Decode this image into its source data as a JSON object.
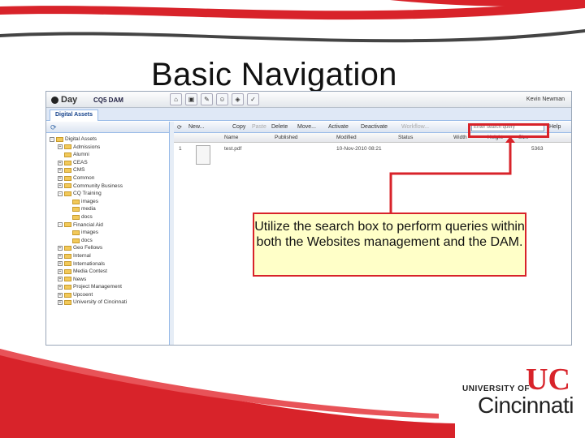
{
  "slide": {
    "title": "Basic Navigation",
    "callout": "Utilize the search box to perform queries within both the Websites management and the DAM.",
    "logo": {
      "top_line": "UNIVERSITY OF",
      "bottom_line": "Cincinnati",
      "mark": "UC"
    },
    "colors": {
      "accent": "#d8232a",
      "callout_bg": "#ffffc8"
    }
  },
  "app": {
    "brand": "Day",
    "product": "CQ5 DAM",
    "toolbar_icons": [
      "home-icon",
      "image-icon",
      "tools-icon",
      "users-icon",
      "site-icon",
      "check-icon"
    ],
    "user": "Kevin Newman"
  },
  "tab": {
    "label": "Digital Assets"
  },
  "tree": {
    "nodes": [
      {
        "label": "Digital Assets",
        "expanded": "-",
        "depth": 0
      },
      {
        "label": "Admissions",
        "expanded": "+",
        "depth": 1
      },
      {
        "label": "Alumni",
        "expanded": "",
        "depth": 1
      },
      {
        "label": "CEAS",
        "expanded": "+",
        "depth": 1
      },
      {
        "label": "CMS",
        "expanded": "+",
        "depth": 1
      },
      {
        "label": "Common",
        "expanded": "+",
        "depth": 1
      },
      {
        "label": "Community Business",
        "expanded": "+",
        "depth": 1
      },
      {
        "label": "CQ Training",
        "expanded": "-",
        "depth": 1
      },
      {
        "label": "images",
        "expanded": "",
        "depth": 2
      },
      {
        "label": "media",
        "expanded": "",
        "depth": 2
      },
      {
        "label": "docs",
        "expanded": "",
        "depth": 2
      },
      {
        "label": "Financial Aid",
        "expanded": "-",
        "depth": 1
      },
      {
        "label": "images",
        "expanded": "",
        "depth": 2
      },
      {
        "label": "docs",
        "expanded": "",
        "depth": 2
      },
      {
        "label": "Geo Fellows",
        "expanded": "+",
        "depth": 1
      },
      {
        "label": "Internal",
        "expanded": "+",
        "depth": 1
      },
      {
        "label": "Internationals",
        "expanded": "+",
        "depth": 1
      },
      {
        "label": "Media Contest",
        "expanded": "+",
        "depth": 1
      },
      {
        "label": "News",
        "expanded": "+",
        "depth": 1
      },
      {
        "label": "Project Management",
        "expanded": "+",
        "depth": 1
      },
      {
        "label": "Upcoent",
        "expanded": "+",
        "depth": 1
      },
      {
        "label": "University of Cincinnati",
        "expanded": "+",
        "depth": 1
      }
    ]
  },
  "grid_toolbar": {
    "buttons": [
      "New...",
      "Copy",
      "Paste",
      "Delete",
      "Move...",
      "Activate",
      "Deactivate",
      "Workflow..."
    ],
    "search_placeholder": "Enter search query",
    "help": "Help"
  },
  "grid": {
    "columns": [
      "Name",
      "Published",
      "Modified",
      "Status",
      "Width",
      "Height",
      "Size"
    ],
    "rows": [
      {
        "index": "1",
        "name": "test.pdf",
        "published": "",
        "modified": "10-Nov-2010 08:21",
        "status": "",
        "width": "",
        "height": "",
        "size": "5363"
      }
    ]
  }
}
